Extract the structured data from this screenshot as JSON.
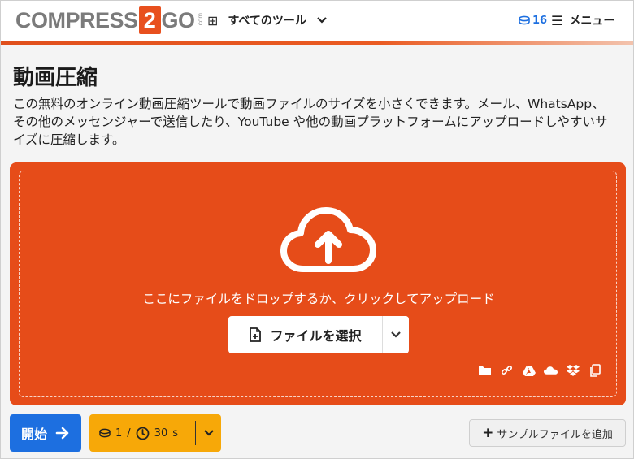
{
  "header": {
    "logo": {
      "left": "COMPRESS",
      "number": "2",
      "right": "GO",
      "suffix": ".com"
    },
    "tools_label": "すべてのツール",
    "credits": "16",
    "menu_label": "メニュー"
  },
  "page": {
    "title": "動画圧縮",
    "description": "この無料のオンライン動画圧縮ツールで動画ファイルのサイズを小さくできます。メール、WhatsApp、その他のメッセンジャーで送信したり、YouTube や他の動画プラットフォームにアップロードしやすいサイズに圧縮します。"
  },
  "dropzone": {
    "drop_text": "ここにファイルをドロップするか、クリックしてアップロード",
    "choose_label": "ファイルを選択",
    "sources": [
      "folder-icon",
      "link-icon",
      "google-drive-icon",
      "onedrive-icon",
      "dropbox-icon",
      "clipboard-icon"
    ]
  },
  "footer": {
    "start_label": "開始",
    "usage": {
      "files": "1",
      "separator": "/",
      "time": "30",
      "unit": "s"
    },
    "sample_label": "サンプルファイルを追加"
  },
  "colors": {
    "accent": "#e64c19",
    "primary": "#1d6fe0",
    "warning": "#f7a808"
  }
}
